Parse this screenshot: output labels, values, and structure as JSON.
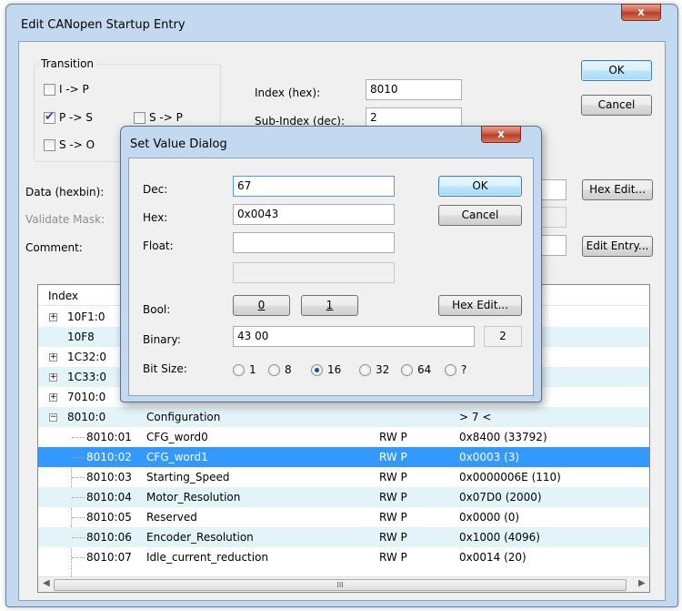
{
  "window": {
    "title": "Edit CANopen Startup Entry",
    "close_glyph": "x"
  },
  "transition": {
    "legend": "Transition",
    "items": [
      {
        "label": "I -> P",
        "checked": false
      },
      {
        "label": "P -> S",
        "checked": true
      },
      {
        "label": "S -> P",
        "checked": false
      },
      {
        "label": "S -> O",
        "checked": false
      }
    ]
  },
  "index": {
    "label": "Index (hex):",
    "value": "8010"
  },
  "subindex": {
    "label": "Sub-Index (dec):",
    "value": "2"
  },
  "buttons": {
    "ok": "OK",
    "cancel": "Cancel",
    "hex_edit": "Hex Edit...",
    "edit_entry": "Edit Entry..."
  },
  "fields": {
    "data_label": "Data (hexbin):",
    "validate_label": "Validate Mask:",
    "comment_label": "Comment:"
  },
  "list": {
    "columns": [
      "Index"
    ],
    "rows": [
      {
        "index": "10F1:0",
        "name": "",
        "flags": "",
        "value": "",
        "expander": "+"
      },
      {
        "index": "10F8",
        "name": "",
        "flags": "",
        "value": "",
        "expander": ""
      },
      {
        "index": "1C32:0",
        "name": "",
        "flags": "",
        "value": "",
        "expander": "+"
      },
      {
        "index": "1C33:0",
        "name": "",
        "flags": "",
        "value": "",
        "expander": "+"
      },
      {
        "index": "7010:0",
        "name": "",
        "flags": "",
        "value": "",
        "expander": "+"
      },
      {
        "index": "8010:0",
        "name": "Configuration",
        "flags": "",
        "value": "> 7 <",
        "expander": "−"
      },
      {
        "index": "8010:01",
        "name": "CFG_word0",
        "flags": "RW P",
        "value": "0x8400 (33792)",
        "expander": ""
      },
      {
        "index": "8010:02",
        "name": "CFG_word1",
        "flags": "RW P",
        "value": "0x0003 (3)",
        "expander": ""
      },
      {
        "index": "8010:03",
        "name": "Starting_Speed",
        "flags": "RW P",
        "value": "0x0000006E (110)",
        "expander": ""
      },
      {
        "index": "8010:04",
        "name": "Motor_Resolution",
        "flags": "RW P",
        "value": "0x07D0 (2000)",
        "expander": ""
      },
      {
        "index": "8010:05",
        "name": "Reserved",
        "flags": "RW P",
        "value": "0x0000 (0)",
        "expander": ""
      },
      {
        "index": "8010:06",
        "name": "Encoder_Resolution",
        "flags": "RW P",
        "value": "0x1000 (4096)",
        "expander": ""
      },
      {
        "index": "8010:07",
        "name": "Idle_current_reduction",
        "flags": "RW P",
        "value": "0x0014 (20)",
        "expander": ""
      }
    ],
    "selected_row": 7,
    "scroll_thumb_glyph": "III"
  },
  "dialog": {
    "title": "Set Value Dialog",
    "dec_label": "Dec:",
    "dec_value": "67",
    "hex_label": "Hex:",
    "hex_value": "0x0043",
    "float_label": "Float:",
    "float_value": "",
    "bool_label": "Bool:",
    "bool_0": "0",
    "bool_1": "1",
    "binary_label": "Binary:",
    "binary_value": "43 00",
    "binary_len": "2",
    "bitsize_label": "Bit Size:",
    "bitsizes": [
      {
        "label": "1",
        "selected": false
      },
      {
        "label": "8",
        "selected": false
      },
      {
        "label": "16",
        "selected": true
      },
      {
        "label": "32",
        "selected": false
      },
      {
        "label": "64",
        "selected": false
      },
      {
        "label": "?",
        "selected": false
      }
    ],
    "ok": "OK",
    "cancel": "Cancel",
    "hex_edit": "Hex Edit..."
  },
  "colors": {
    "selection": "#3399ff",
    "alt_row": "#e3f4f9",
    "chrome": "#c3d9ef"
  }
}
